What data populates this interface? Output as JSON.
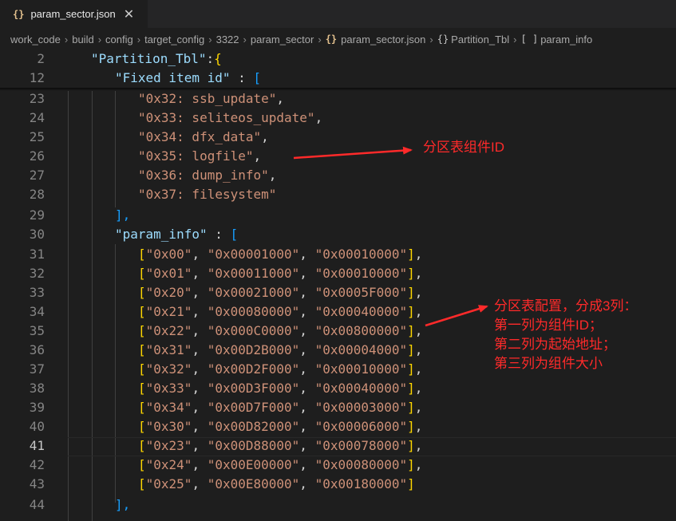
{
  "tab": {
    "icon": "{}",
    "title": "param_sector.json",
    "close": "✕"
  },
  "breadcrumb": {
    "items": [
      "work_code",
      "build",
      "config",
      "target_config",
      "3322",
      "param_sector"
    ],
    "file_icon": "{}",
    "file": "param_sector.json",
    "symbol1_icon": "{}",
    "symbol1": "Partition_Tbl",
    "symbol2_icon": "[ ]",
    "symbol2": "param_info"
  },
  "sticky": [
    {
      "ln": "2",
      "key": "\"Partition_Tbl\"",
      "tail": ":"
    },
    {
      "ln": "12",
      "key": "\"Fixed item id\"",
      "tail": " : "
    }
  ],
  "fixed_items": [
    {
      "ln": "23",
      "text": "\"0x32: ssb_update\"",
      "comma": ","
    },
    {
      "ln": "24",
      "text": "\"0x33: seliteos_update\"",
      "comma": ","
    },
    {
      "ln": "25",
      "text": "\"0x34: dfx_data\"",
      "comma": ","
    },
    {
      "ln": "26",
      "text": "\"0x35: logfile\"",
      "comma": ","
    },
    {
      "ln": "27",
      "text": "\"0x36: dump_info\"",
      "comma": ","
    },
    {
      "ln": "28",
      "text": "\"0x37: filesystem\"",
      "comma": ""
    }
  ],
  "close_fixed": {
    "ln": "29",
    "text": "],"
  },
  "param_header": {
    "ln": "30",
    "key": "\"param_info\"",
    "tail": " : "
  },
  "param_rows": [
    {
      "ln": "31",
      "id": "\"0x00\"",
      "addr": "\"0x00001000\"",
      "size": "\"0x00010000\"",
      "comma": ","
    },
    {
      "ln": "32",
      "id": "\"0x01\"",
      "addr": "\"0x00011000\"",
      "size": "\"0x00010000\"",
      "comma": ","
    },
    {
      "ln": "33",
      "id": "\"0x20\"",
      "addr": "\"0x00021000\"",
      "size": "\"0x0005F000\"",
      "comma": ","
    },
    {
      "ln": "34",
      "id": "\"0x21\"",
      "addr": "\"0x00080000\"",
      "size": "\"0x00040000\"",
      "comma": ","
    },
    {
      "ln": "35",
      "id": "\"0x22\"",
      "addr": "\"0x000C0000\"",
      "size": "\"0x00800000\"",
      "comma": ","
    },
    {
      "ln": "36",
      "id": "\"0x31\"",
      "addr": "\"0x00D2B000\"",
      "size": "\"0x00004000\"",
      "comma": ","
    },
    {
      "ln": "37",
      "id": "\"0x32\"",
      "addr": "\"0x00D2F000\"",
      "size": "\"0x00010000\"",
      "comma": ","
    },
    {
      "ln": "38",
      "id": "\"0x33\"",
      "addr": "\"0x00D3F000\"",
      "size": "\"0x00040000\"",
      "comma": ","
    },
    {
      "ln": "39",
      "id": "\"0x34\"",
      "addr": "\"0x00D7F000\"",
      "size": "\"0x00003000\"",
      "comma": ","
    },
    {
      "ln": "40",
      "id": "\"0x30\"",
      "addr": "\"0x00D82000\"",
      "size": "\"0x00006000\"",
      "comma": ","
    },
    {
      "ln": "41",
      "id": "\"0x23\"",
      "addr": "\"0x00D88000\"",
      "size": "\"0x00078000\"",
      "comma": ","
    },
    {
      "ln": "42",
      "id": "\"0x24\"",
      "addr": "\"0x00E00000\"",
      "size": "\"0x00080000\"",
      "comma": ","
    },
    {
      "ln": "43",
      "id": "\"0x25\"",
      "addr": "\"0x00E80000\"",
      "size": "\"0x00180000\"",
      "comma": ""
    }
  ],
  "close_param": {
    "ln": "44",
    "text": "],"
  },
  "active_line": "41",
  "annotations": {
    "a1": "分区表组件ID",
    "a2": [
      "分区表配置，分成3列：",
      "第一列为组件ID；",
      "第二列为起始地址；",
      "第三列为组件大小"
    ]
  },
  "colors": {
    "annotation": "#ff2a2a",
    "key": "#9cdcfe",
    "string": "#ce9178",
    "bracket_gold": "#ffd700",
    "bracket_pink": "#da70d6",
    "bracket_blue": "#179fff"
  }
}
